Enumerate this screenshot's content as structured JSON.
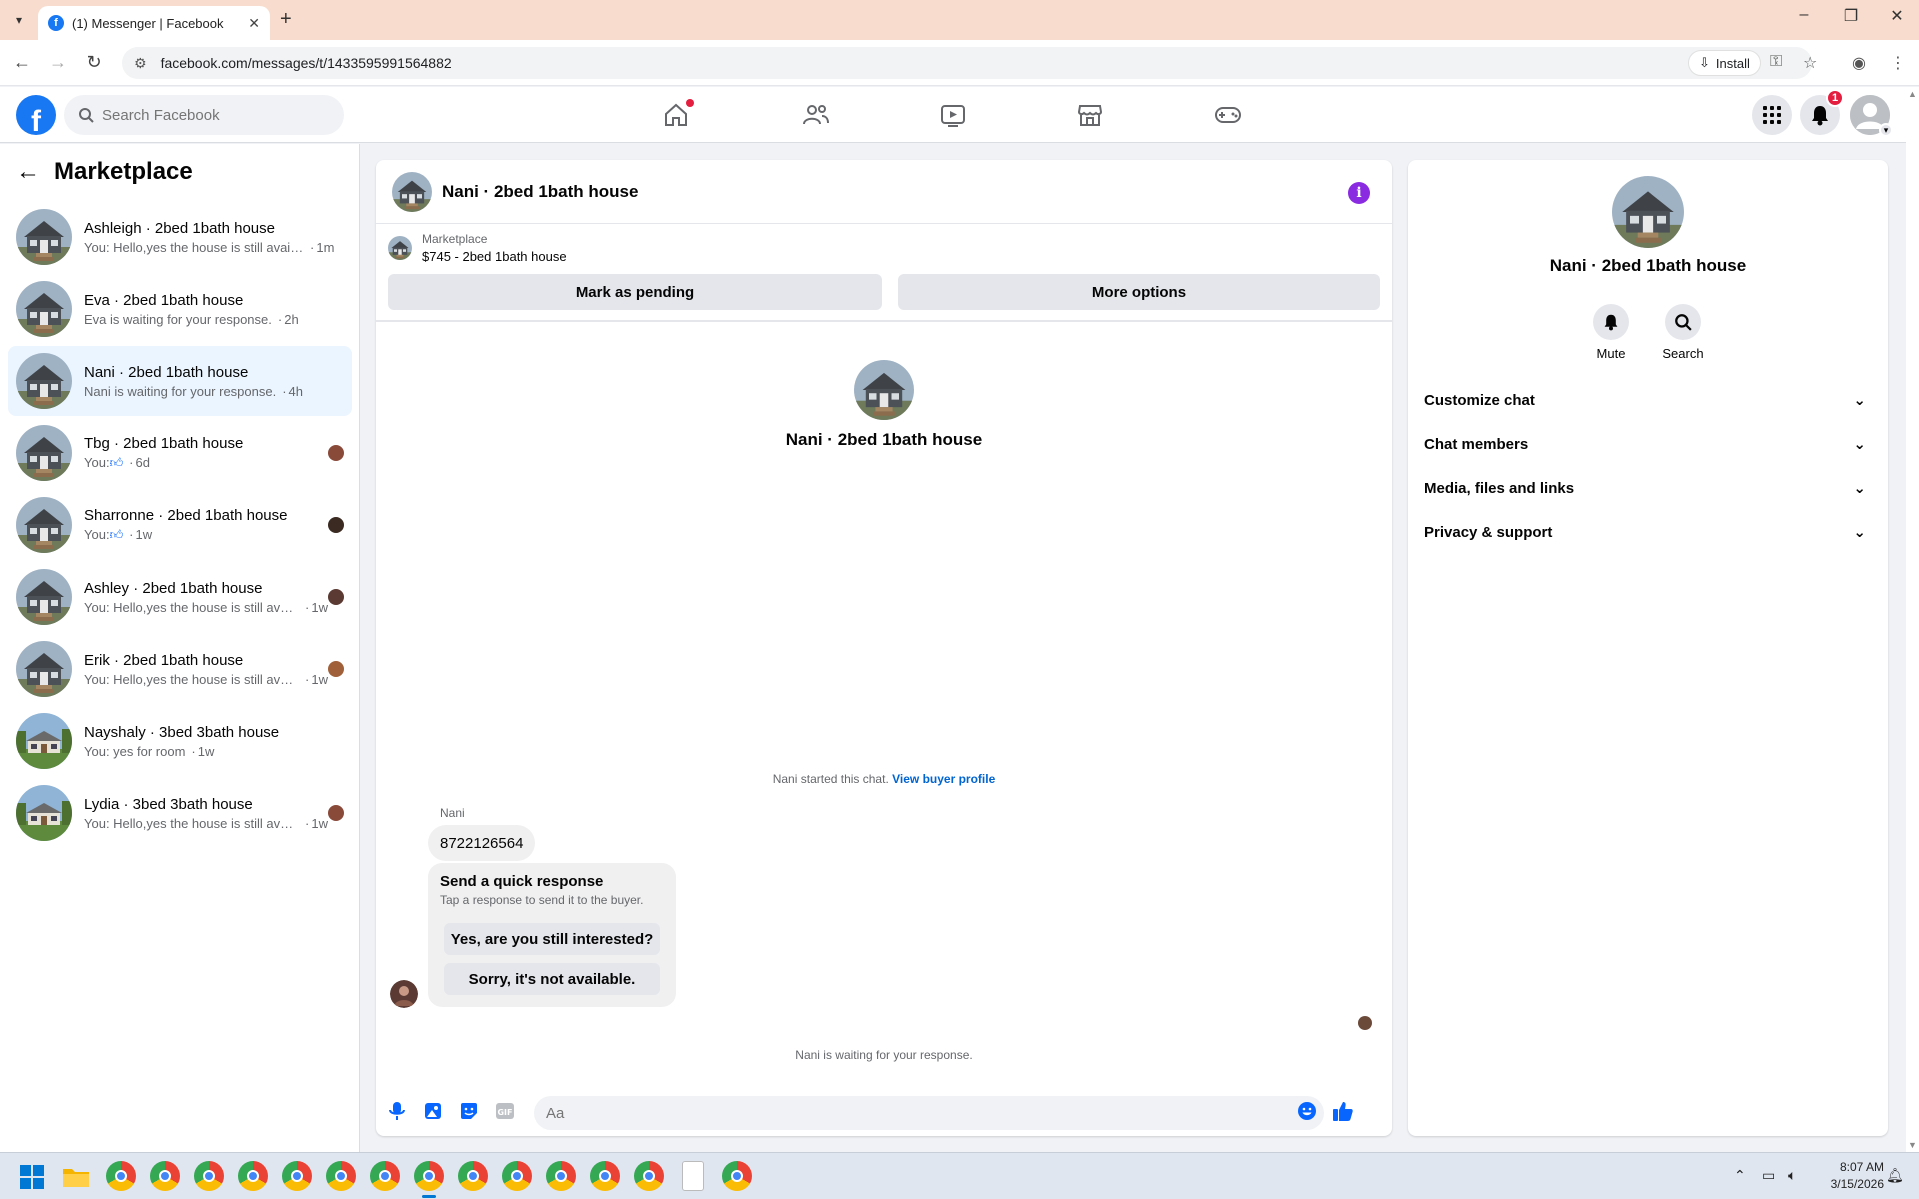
{
  "browser": {
    "tab_title": "(1) Messenger | Facebook",
    "url": "facebook.com/messages/t/1433595991564882",
    "install_label": "Install"
  },
  "fb": {
    "search_placeholder": "Search Facebook",
    "notifications_count": "1",
    "brand_color": "#1877f2"
  },
  "sidebar": {
    "title": "Marketplace",
    "conversations": [
      {
        "name": "Ashleigh · 2bed 1bath house",
        "message": "You: Hello,yes the house is still availa...",
        "time": "1m",
        "seen": false
      },
      {
        "name": "Eva · 2bed 1bath house",
        "message": "Eva is waiting for your response.",
        "time": "2h",
        "seen": false
      },
      {
        "name": "Nani · 2bed 1bath house",
        "message": "Nani is waiting for your response.",
        "time": "4h",
        "seen": false,
        "active": true
      },
      {
        "name": "Tbg · 2bed 1bath house",
        "message": "You: ",
        "time": "6d",
        "seen": true,
        "like": true
      },
      {
        "name": "Sharronne · 2bed 1bath house",
        "message": "You: ",
        "time": "1w",
        "seen": true,
        "like": true
      },
      {
        "name": "Ashley · 2bed 1bath house",
        "message": "You: Hello,yes the house is still avai...",
        "time": "1w",
        "seen": true
      },
      {
        "name": "Erik · 2bed 1bath house",
        "message": "You: Hello,yes the house is still avai...",
        "time": "1w",
        "seen": true
      },
      {
        "name": "Nayshaly · 3bed 3bath house",
        "message": "You: yes for room",
        "time": "1w",
        "seen": false,
        "house2": true
      },
      {
        "name": "Lydia · 3bed 3bath house",
        "message": "You: Hello,yes the house is still avai...",
        "time": "1w",
        "seen": true,
        "house2": true
      }
    ]
  },
  "chat": {
    "title": "Nani · 2bed 1bath house",
    "marketplace_label": "Marketplace",
    "listing": "$745 - 2bed 1bath house",
    "mark_pending": "Mark as pending",
    "more_options": "More options",
    "intro_name": "Nani · 2bed 1bath house",
    "started_text": "Nani started this chat.",
    "view_buyer_profile": "View buyer profile",
    "sender_name": "Nani",
    "message": "8722126564",
    "quick_title": "Send a quick response",
    "quick_sub": "Tap a response to send it to the buyer.",
    "quick_1": "Yes, are you still interested?",
    "quick_2": "Sorry, it's not available.",
    "waiting_text": "Nani is waiting for your response.",
    "composer_placeholder": "Aa"
  },
  "info": {
    "name": "Nani · 2bed 1bath house",
    "mute": "Mute",
    "search": "Search",
    "sections": [
      "Customize chat",
      "Chat members",
      "Media, files and links",
      "Privacy & support"
    ]
  },
  "taskbar": {
    "time": "8:07 AM",
    "date": "3/15/2026"
  }
}
